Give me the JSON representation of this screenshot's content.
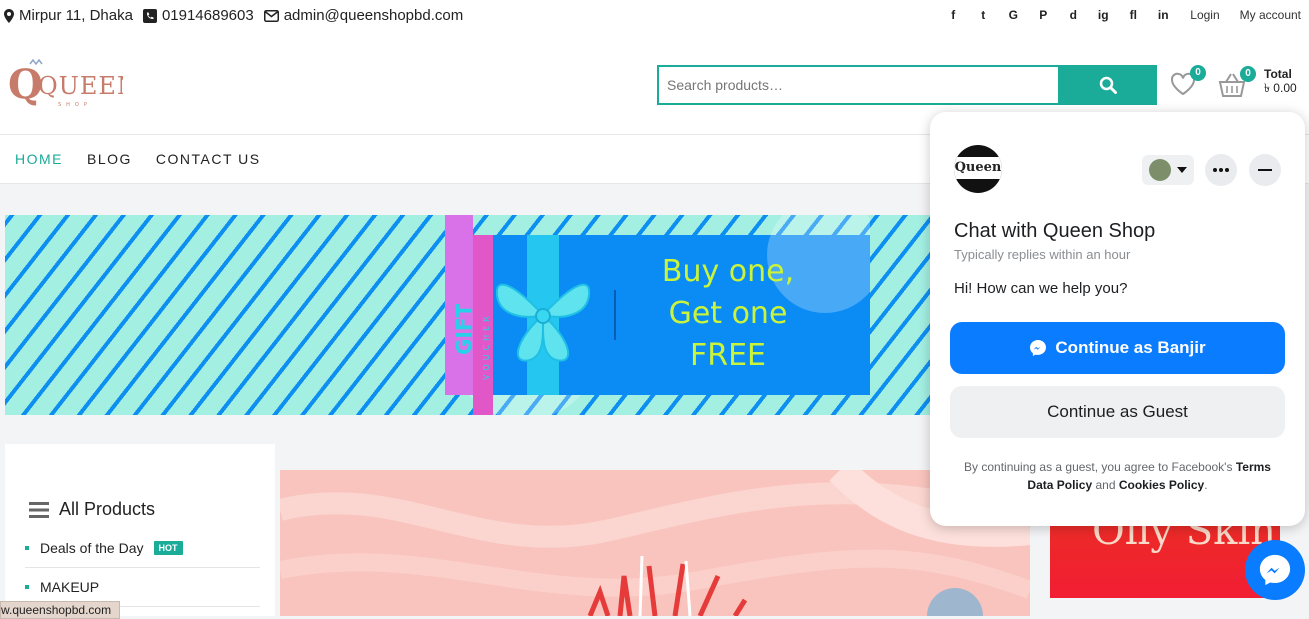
{
  "topbar": {
    "address": "Mirpur 11, Dhaka",
    "phone": "01914689603",
    "email": "admin@queenshopbd.com",
    "social": [
      "f",
      "t",
      "G",
      "P",
      "d",
      "ig",
      "fl",
      "in"
    ],
    "login": "Login",
    "account": "My account"
  },
  "header": {
    "logo_text": "QUEEN",
    "logo_sub": "SHOP",
    "search_placeholder": "Search products…",
    "wishlist_count": "0",
    "cart_count": "0",
    "total_label": "Total",
    "total_value": "৳ 0.00"
  },
  "nav": {
    "items": [
      {
        "label": "HOME"
      },
      {
        "label": "BLOG"
      },
      {
        "label": "CONTACT US"
      }
    ]
  },
  "banner": {
    "gift_label": "GIFT",
    "voucher_label": "VOUCHER",
    "offer_line1": "Buy one,",
    "offer_line2": "Get one",
    "offer_line3": "FREE"
  },
  "sidebar": {
    "title": "All Products",
    "categories": [
      {
        "label": "Deals of the Day",
        "badge": "HOT"
      },
      {
        "label": "MAKEUP"
      }
    ]
  },
  "promo": {
    "text": "Oily Skin"
  },
  "statusbar": {
    "url": "w.queenshopbd.com"
  },
  "chat": {
    "avatar_text": "Queen",
    "title": "Chat with Queen Shop",
    "subtitle": "Typically replies within an hour",
    "greeting": "Hi! How can we help you?",
    "primary_button": "Continue as Banjir",
    "secondary_button": "Continue as Guest",
    "legal_prefix": "By continuing as a guest, you agree to Facebook's",
    "terms": "Terms",
    "data_policy": "Data Policy",
    "and": "and",
    "cookies_policy": "Cookies Policy"
  },
  "colors": {
    "accent": "#1aab99",
    "messenger_blue": "#0a7cff"
  }
}
